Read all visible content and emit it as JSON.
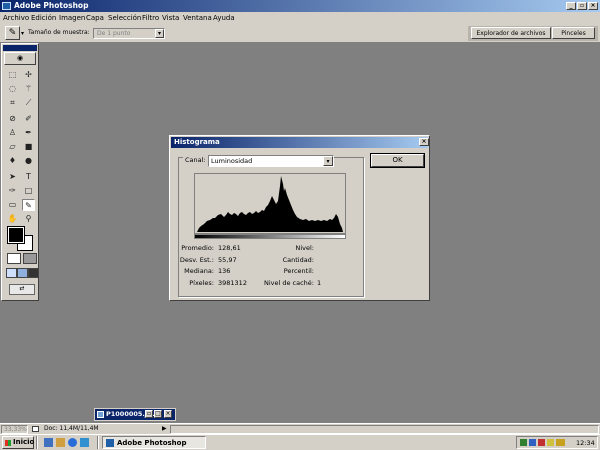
{
  "window": {
    "title": "Adobe Photoshop"
  },
  "menu": [
    "Archivo",
    "Edición",
    "Imagen",
    "Capa",
    "Selección",
    "Filtro",
    "Vista",
    "Ventana",
    "Ayuda"
  ],
  "options": {
    "sample_size_label": "Tamaño de muestra:",
    "sample_size_value": "De 1 punto",
    "tabs": [
      "Explorador de archivos",
      "Pinceles"
    ]
  },
  "histogram_dialog": {
    "title": "Histograma",
    "channel_label": "Canal:",
    "channel_value": "Luminosidad",
    "ok_label": "OK",
    "stats_left": [
      {
        "label": "Promedio:",
        "value": "128,61"
      },
      {
        "label": "Desv. Est.:",
        "value": "55,97"
      },
      {
        "label": "Mediana:",
        "value": "136"
      },
      {
        "label": "Píxeles:",
        "value": "3981312"
      }
    ],
    "stats_right": [
      {
        "label": "Nivel:",
        "value": ""
      },
      {
        "label": "Cantidad:",
        "value": ""
      },
      {
        "label": "Percentil:",
        "value": ""
      },
      {
        "label": "Nivel de caché:",
        "value": "1"
      }
    ]
  },
  "minimized_doc": {
    "title": "P1000005.J..."
  },
  "status": {
    "zoom": "33,33%",
    "doc": "Doc: 11,4M/11,4M"
  },
  "taskbar": {
    "start_label": "Inicio",
    "app_label": "Adobe Photoshop",
    "clock": "12:34"
  },
  "colors": {
    "desktop": "#808080",
    "chrome": "#d4d0c8",
    "title_start": "#0a246a",
    "title_end": "#a6caf0"
  }
}
